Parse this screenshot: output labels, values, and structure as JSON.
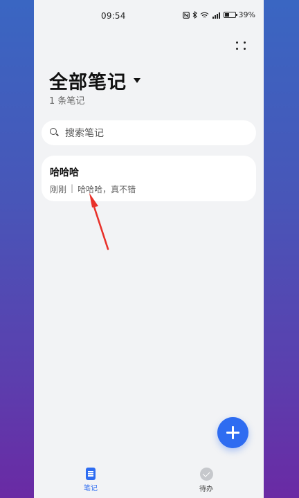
{
  "status_bar": {
    "time": "09:54",
    "battery_text": "39%",
    "battery_level": 0.39,
    "icons": [
      "nfc-icon",
      "bluetooth-icon",
      "wifi-icon",
      "signal-icon",
      "battery-icon"
    ]
  },
  "header": {
    "title": "全部笔记",
    "subtitle": "1 条笔记"
  },
  "search": {
    "placeholder": "搜索笔记"
  },
  "notes": [
    {
      "title": "哈哈哈",
      "time": "刚刚",
      "separator": "|",
      "preview": "哈哈哈，真不错"
    }
  ],
  "bottom_nav": {
    "notes_label": "笔记",
    "todo_label": "待办"
  },
  "colors": {
    "accent": "#2e6cf1",
    "annotation_arrow": "#e8312a",
    "page_bg": "#f2f3f5"
  }
}
